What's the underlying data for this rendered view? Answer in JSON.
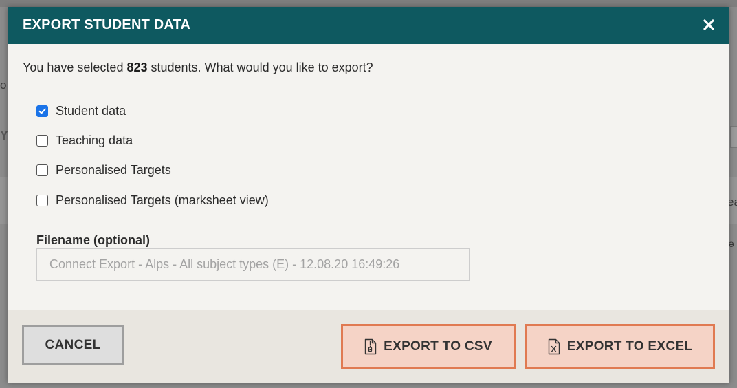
{
  "background": {
    "fragments": [
      "o",
      "Y",
      "ea",
      "ə"
    ]
  },
  "modal": {
    "title": "EXPORT STUDENT DATA",
    "close_icon": "close-icon",
    "intro_prefix": "You have selected ",
    "selected_count": "823",
    "intro_suffix": " students. What would you like to export?",
    "options": [
      {
        "label": "Student data",
        "checked": true
      },
      {
        "label": "Teaching data",
        "checked": false
      },
      {
        "label": "Personalised Targets",
        "checked": false
      },
      {
        "label": "Personalised Targets (marksheet view)",
        "checked": false
      }
    ],
    "filename_label": "Filename (optional)",
    "filename_placeholder": "Connect Export - Alps - All subject types (E) - 12.08.20 16:49:26",
    "filename_value": "",
    "cancel_label": "CANCEL",
    "export_csv_label": "EXPORT TO CSV",
    "export_csv_icon": "csv-file-icon",
    "export_excel_label": "EXPORT TO EXCEL",
    "export_excel_icon": "excel-file-icon"
  },
  "colors": {
    "header_bg": "#0e5960",
    "accent_orange": "#e07a52",
    "checkbox_checked": "#1a73e8"
  }
}
